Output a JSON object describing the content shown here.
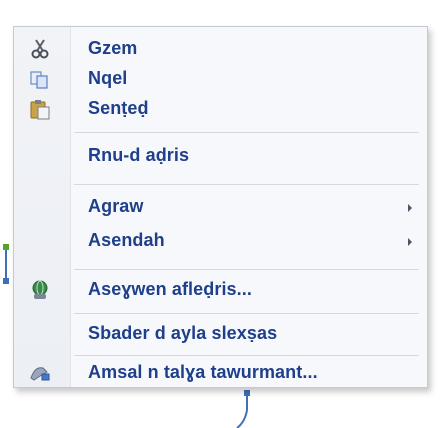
{
  "context_menu": {
    "items": [
      {
        "label": "Gzem",
        "icon": "scissors-icon"
      },
      {
        "label": "Nqel",
        "icon": "copy-icon"
      },
      {
        "label": "Senṭeḍ",
        "icon": "paste-icon"
      },
      {
        "label": "Rnu-d aḍris"
      },
      {
        "label": "Agraw",
        "submenu": true
      },
      {
        "label": "Asendah",
        "submenu": true
      },
      {
        "label": "Aseɣwen afleḍris...",
        "icon": "hyperlink-icon"
      },
      {
        "label": "Sbader d ayla slexṣas"
      },
      {
        "label": "Amsal n talɣa tawurmant...",
        "icon": "format-shape-icon"
      }
    ]
  }
}
